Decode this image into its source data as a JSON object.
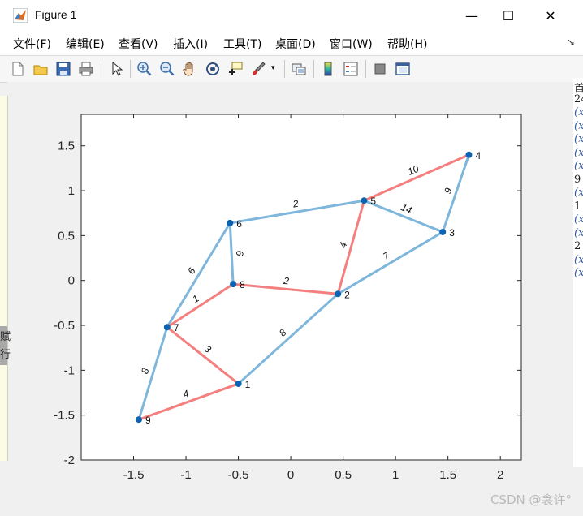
{
  "window": {
    "title": "Figure 1",
    "controls": [
      "—",
      "☐",
      "✕"
    ]
  },
  "menubar": {
    "items": [
      "文件(F)",
      "编辑(E)",
      "查看(V)",
      "插入(I)",
      "工具(T)",
      "桌面(D)",
      "窗口(W)",
      "帮助(H)"
    ],
    "end_glyph": "↘"
  },
  "toolbar": {
    "icons": [
      "new-figure-icon",
      "open-file-icon",
      "save-icon",
      "print-icon",
      "edit-plot-arrow-icon",
      "zoom-in-icon",
      "zoom-out-icon",
      "pan-hand-icon",
      "rotate-3d-icon",
      "data-cursor-icon",
      "brush-icon",
      "link-plot-icon",
      "colorbar-icon",
      "legend-icon",
      "hide-plot-tools-icon",
      "show-plot-tools-icon"
    ]
  },
  "side_text": {
    "right": [
      "首",
      "24",
      "(x",
      "(x",
      "(x",
      "(x",
      "(x",
      "9",
      "(x",
      "1",
      "(x",
      "(x",
      "2",
      "(x",
      "(x"
    ],
    "left": [
      "赋",
      "行"
    ]
  },
  "watermark": "CSDN @衾许°",
  "chart_data": {
    "type": "graph",
    "xlim": [
      -2,
      2.2
    ],
    "ylim": [
      -2,
      1.85
    ],
    "xticks": [
      -1.5,
      -1,
      -0.5,
      0,
      0.5,
      1,
      1.5,
      2
    ],
    "xtick_labels": [
      "-1.5",
      "-1",
      "-0.5",
      "0",
      "0.5",
      "1",
      "1.5",
      "2"
    ],
    "yticks": [
      -2,
      -1.5,
      -1,
      -0.5,
      0,
      0.5,
      1,
      1.5
    ],
    "ytick_labels": [
      "-2",
      "-1.5",
      "-1",
      "-0.5",
      "0",
      "0.5",
      "1",
      "1.5"
    ],
    "grid": false,
    "colors": {
      "edge": "#7fb6dc",
      "mst_edge": "#f47f7f",
      "node": "#0b63b3",
      "axes_bg": "#ffffff"
    },
    "nodes": [
      {
        "id": "1",
        "x": -0.5,
        "y": -1.15
      },
      {
        "id": "2",
        "x": 0.45,
        "y": -0.15
      },
      {
        "id": "3",
        "x": 1.45,
        "y": 0.54
      },
      {
        "id": "4",
        "x": 1.7,
        "y": 1.4
      },
      {
        "id": "5",
        "x": 0.7,
        "y": 0.89
      },
      {
        "id": "6",
        "x": -0.58,
        "y": 0.64
      },
      {
        "id": "7",
        "x": -1.18,
        "y": -0.52
      },
      {
        "id": "8",
        "x": -0.55,
        "y": -0.04
      },
      {
        "id": "9",
        "x": -1.45,
        "y": -1.55
      }
    ],
    "edges": [
      {
        "source": "4",
        "target": "5",
        "weight": "10",
        "mst": true
      },
      {
        "source": "4",
        "target": "3",
        "weight": "9",
        "mst": false
      },
      {
        "source": "5",
        "target": "3",
        "weight": "14",
        "mst": false
      },
      {
        "source": "6",
        "target": "5",
        "weight": "2",
        "mst": false
      },
      {
        "source": "5",
        "target": "2",
        "weight": "4",
        "mst": true
      },
      {
        "source": "3",
        "target": "2",
        "weight": "7",
        "mst": false
      },
      {
        "source": "6",
        "target": "8",
        "weight": "6",
        "mst": false
      },
      {
        "source": "6",
        "target": "7",
        "weight": "6",
        "mst": false
      },
      {
        "source": "8",
        "target": "2",
        "weight": "2",
        "mst": true
      },
      {
        "source": "7",
        "target": "8",
        "weight": "1",
        "mst": true
      },
      {
        "source": "7",
        "target": "1",
        "weight": "3",
        "mst": true
      },
      {
        "source": "2",
        "target": "1",
        "weight": "8",
        "mst": false
      },
      {
        "source": "7",
        "target": "9",
        "weight": "8",
        "mst": false
      },
      {
        "source": "9",
        "target": "1",
        "weight": "4",
        "mst": true
      }
    ]
  }
}
